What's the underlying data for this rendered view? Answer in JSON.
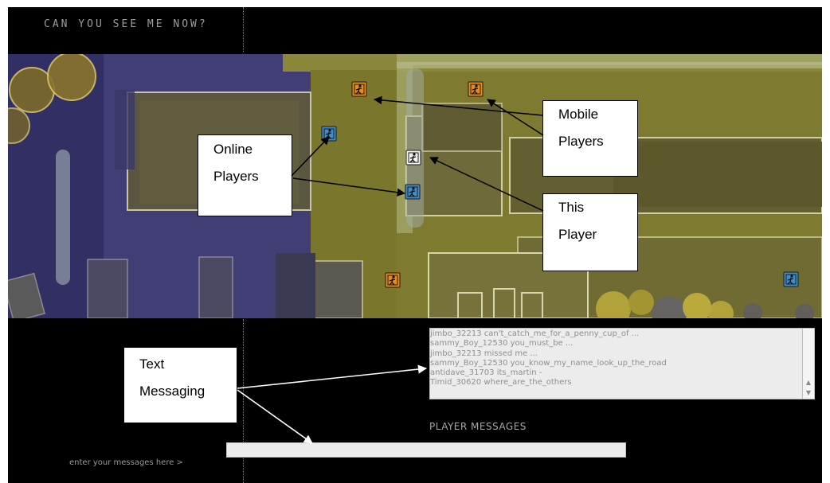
{
  "game": {
    "title": "CAN YOU SEE ME NOW?",
    "accent_orange": "#e8891c",
    "accent_blue": "#3f8ec9",
    "player_self": "#f3f3f3"
  },
  "map": {
    "mobile_player_icons": [
      "runner-icon",
      "runner-icon",
      "runner-icon"
    ],
    "online_player_icons": [
      "runner-icon",
      "runner-icon",
      "runner-icon"
    ],
    "this_player_icon": "runner-icon"
  },
  "chat": {
    "messages": [
      "jimbo_32213 can't_catch_me_for_a_penny_cup_of ...",
      "sammy_Boy_12530 you_must_be ...",
      "jimbo_32213 missed me ...",
      "sammy_Boy_12530 you_know_my_name_look_up_the_road",
      "antidave_31703 its_martin -",
      "Timid_30620 where_are_the_others"
    ],
    "panel_label": "PLAYER MESSAGES",
    "input_label": "enter your messages here >",
    "input_value": ""
  },
  "callouts": {
    "online_players": [
      "Online",
      "Players"
    ],
    "mobile_players": [
      "Mobile",
      "Players"
    ],
    "this_player": [
      "This",
      "Player"
    ],
    "text_messaging": [
      "Text",
      "Messaging"
    ]
  }
}
